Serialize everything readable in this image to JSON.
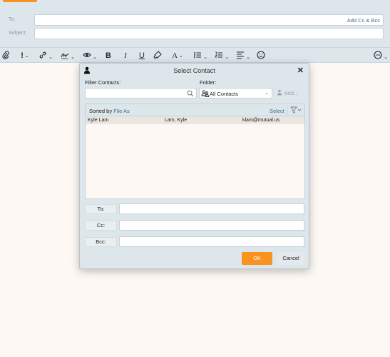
{
  "compose": {
    "to_label": "To:",
    "add_cc_bcc": "Add Cc & Bcc",
    "subject_label": "Subject:"
  },
  "toolbar": {
    "icons": [
      "paperclip-icon",
      "importance-icon",
      "link-icon",
      "signature-icon",
      "view-icon",
      "bold-icon",
      "italic-icon",
      "underline-icon",
      "format-painter-icon",
      "font-icon",
      "bullets-icon",
      "numbering-icon",
      "align-icon",
      "emoji-icon",
      "more-icon"
    ],
    "bold": "B",
    "italic": "I",
    "underline": "U",
    "font": "A",
    "importance": "!"
  },
  "dialog": {
    "title": "Select Contact",
    "close": "✕",
    "filter_label": "Filter Contacts:",
    "filter_value": "",
    "folder_label": "Folder:",
    "folder_value": "All Contacts",
    "add_label": "Add...",
    "sorted_by_prefix": "Sorted by",
    "sorted_by_field": "File As",
    "select_label": "Select",
    "contacts": [
      {
        "name": "Kyle Lam",
        "file_as": "Lam, Kyle",
        "email": "klam@mutual.us"
      }
    ],
    "to_button": "To:",
    "cc_button": "Cc:",
    "bcc_button": "Bcc:",
    "to_value": "",
    "cc_value": "",
    "bcc_value": "",
    "ok_label": "OK",
    "cancel_label": "Cancel"
  },
  "colors": {
    "accent": "#f7931e",
    "link": "#3c6e8f",
    "panel": "#dde6ea",
    "page": "#fdf8f4"
  }
}
